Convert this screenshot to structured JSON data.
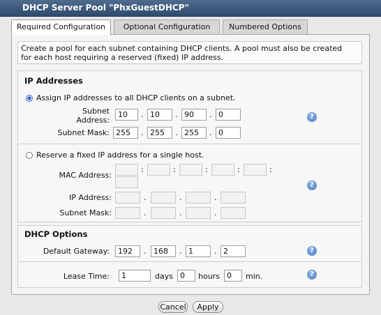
{
  "window": {
    "title": "DHCP Server Pool \"PhxGuestDHCP\""
  },
  "tabs": [
    {
      "label": "Required Configuration"
    },
    {
      "label": "Optional Configuration"
    },
    {
      "label": "Numbered Options"
    }
  ],
  "info_text_1": "Create a pool for each subnet containing DHCP clients. A pool must also be created",
  "info_text_2": "for each host requiring a reserved (fixed) IP address.",
  "ip_addresses": {
    "title": "IP Addresses",
    "assign_subnet_label": "Assign IP addresses to all DHCP clients on a subnet.",
    "subnet_address_label_1": "Subnet",
    "subnet_address_label_2": "Address:",
    "subnet_address": [
      "10",
      "10",
      "90",
      "0"
    ],
    "subnet_mask_label": "Subnet Mask:",
    "subnet_mask": [
      "255",
      "255",
      "255",
      "0"
    ],
    "fixed_label": "Reserve a fixed IP address for a single host.",
    "mac_label": "MAC Address:",
    "ip_label": "IP Address:",
    "fixed_mask_label": "Subnet Mask:"
  },
  "dhcp_options": {
    "title": "DHCP Options",
    "gateway_label": "Default Gateway:",
    "gateway": [
      "192",
      "168",
      "1",
      "2"
    ],
    "lease_label": "Lease Time:",
    "lease_days": "1",
    "days_label": "days",
    "lease_hours": "0",
    "hours_label": "hours",
    "lease_min": "0",
    "min_label": "min."
  },
  "help_glyph": "?",
  "buttons": {
    "cancel": "Cancel",
    "apply": "Apply"
  }
}
